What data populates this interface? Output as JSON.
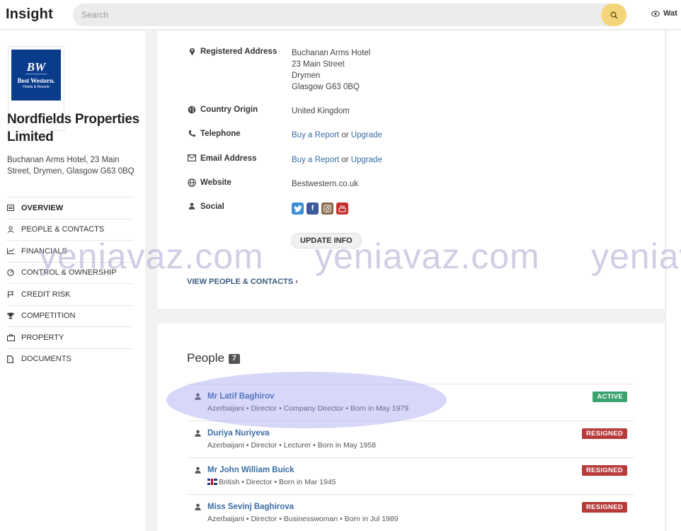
{
  "app": {
    "title": "Insight"
  },
  "search": {
    "placeholder": "Search"
  },
  "header": {
    "watch_label": "Wat"
  },
  "company": {
    "name": "Nordfields Properties Limited",
    "address": "Buchanan Arms Hotel, 23 Main Street, Drymen, Glasgow G63 0BQ",
    "logo": {
      "mark": "BW",
      "name": "Best Western.",
      "tagline": "Hotels & Resorts",
      "color": "#0b3c8c"
    }
  },
  "nav": [
    {
      "label": "OVERVIEW",
      "icon": "overview-icon",
      "active": true
    },
    {
      "label": "PEOPLE & CONTACTS",
      "icon": "person-icon"
    },
    {
      "label": "FINANCIALS",
      "icon": "chart-icon"
    },
    {
      "label": "CONTROL & OWNERSHIP",
      "icon": "gauge-icon"
    },
    {
      "label": "CREDIT RISK",
      "icon": "flag-icon"
    },
    {
      "label": "COMPETITION",
      "icon": "trophy-icon"
    },
    {
      "label": "PROPERTY",
      "icon": "briefcase-icon"
    },
    {
      "label": "DOCUMENTS",
      "icon": "document-icon"
    }
  ],
  "details": {
    "registered_address": {
      "label": "Registered Address",
      "lines": [
        "Buchanan Arms Hotel",
        "23 Main Street",
        "Drymen",
        "Glasgow G63 0BQ"
      ]
    },
    "country": {
      "label": "Country Origin",
      "value": "United Kingdom"
    },
    "telephone": {
      "label": "Telephone",
      "buy": "Buy a Report",
      "or": "or",
      "upgrade": "Upgrade"
    },
    "email": {
      "label": "Email Address",
      "buy": "Buy a Report",
      "or": "or",
      "upgrade": "Upgrade"
    },
    "website": {
      "label": "Website",
      "value": "Bestwestern.co.uk"
    },
    "social": {
      "label": "Social",
      "networks": [
        "twitter",
        "facebook",
        "instagram",
        "youtube"
      ]
    },
    "update_button": "UPDATE INFO",
    "view_people": "VIEW PEOPLE & CONTACTS"
  },
  "people": {
    "title": "People",
    "count": "7",
    "list": [
      {
        "name": "Mr Latif Baghirov",
        "details": "Azerbaijani • Director • Company Director • Born in May 1979",
        "status": "ACTIVE",
        "status_color": "#3aa26d"
      },
      {
        "name": "Duriya Nuriyeva",
        "details": "Azerbaijani • Director • Lecturer • Born in May 1958",
        "status": "RESIGNED",
        "status_color": "#b83a3a"
      },
      {
        "name": "Mr John William Buick",
        "details": "British • Director • Born in Mar 1945",
        "status": "RESIGNED",
        "status_color": "#b83a3a",
        "flag": "uk"
      },
      {
        "name": "Miss Sevinj Baghirova",
        "details": "Azerbaijani • Director • Businesswoman • Born in Jul 1989",
        "status": "RESIGNED",
        "status_color": "#b83a3a"
      }
    ]
  },
  "watermark": {
    "text": "yeniavaz.com"
  }
}
